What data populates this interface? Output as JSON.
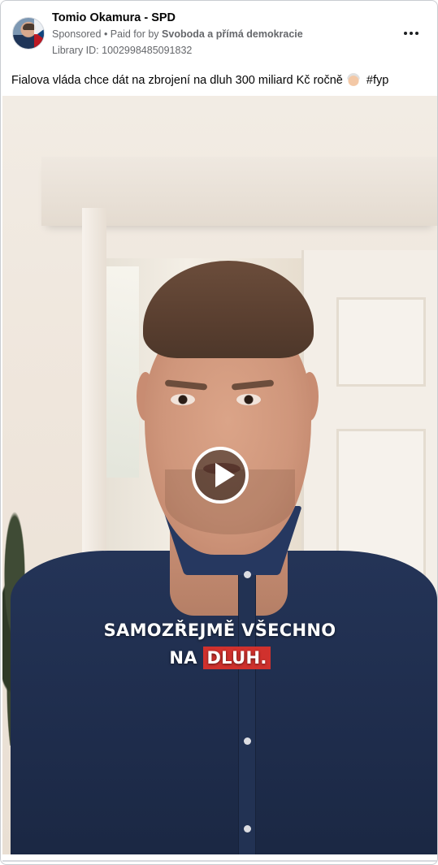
{
  "post": {
    "author": "Tomio Okamura - SPD",
    "sponsored_label": "Sponsored",
    "paid_for_prefix": "• Paid for by",
    "paid_for_by": "Svoboda a přímá demokracie",
    "library_id": "Library ID: 1002998485091832",
    "caption_text": "Fialova vláda chce dát na zbrojení na dluh 300 miliard Kč ročně",
    "caption_emoji_icon": "old-man-emoji-icon",
    "caption_hashtag": "#fyp"
  },
  "video": {
    "subtitle_line1": "SAMOZŘEJMĚ VŠECHNO",
    "subtitle_line2_prefix": "NA",
    "subtitle_line2_highlight": "DLUH.",
    "highlight_color": "#d0312d",
    "play_icon": "play-icon"
  },
  "icons": {
    "more_options": "more-options-icon"
  }
}
